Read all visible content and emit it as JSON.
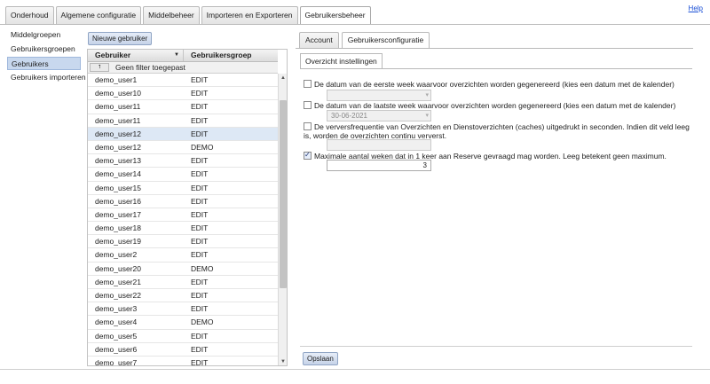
{
  "top_tabs": [
    {
      "label": "Onderhoud",
      "active": false
    },
    {
      "label": "Algemene configuratie",
      "active": false
    },
    {
      "label": "Middelbeheer",
      "active": false
    },
    {
      "label": "Importeren en Exporteren",
      "active": false
    },
    {
      "label": "Gebruikersbeheer",
      "active": true
    }
  ],
  "help_label": "Help",
  "left_nav": [
    {
      "label": "Middelgroepen",
      "active": false
    },
    {
      "label": "Gebruikersgroepen",
      "active": false
    },
    {
      "label": "Gebruikers",
      "active": true
    },
    {
      "label": "Gebruikers importeren",
      "active": false
    }
  ],
  "new_user_button": "Nieuwe gebruiker",
  "grid": {
    "col_user": "Gebruiker",
    "col_group": "Gebruikersgroep",
    "filter_button": "⭡",
    "filter_text": "Geen filter toegepast",
    "rows": [
      {
        "user": "demo_user1",
        "group": "EDIT"
      },
      {
        "user": "demo_user10",
        "group": "EDIT"
      },
      {
        "user": "demo_user11",
        "group": "EDIT"
      },
      {
        "user": "demo_user11",
        "group": "EDIT"
      },
      {
        "user": "demo_user12",
        "group": "EDIT",
        "selected": true
      },
      {
        "user": "demo_user12",
        "group": "DEMO"
      },
      {
        "user": "demo_user13",
        "group": "EDIT"
      },
      {
        "user": "demo_user14",
        "group": "EDIT"
      },
      {
        "user": "demo_user15",
        "group": "EDIT"
      },
      {
        "user": "demo_user16",
        "group": "EDIT"
      },
      {
        "user": "demo_user17",
        "group": "EDIT"
      },
      {
        "user": "demo_user18",
        "group": "EDIT"
      },
      {
        "user": "demo_user19",
        "group": "EDIT"
      },
      {
        "user": "demo_user2",
        "group": "EDIT"
      },
      {
        "user": "demo_user20",
        "group": "DEMO"
      },
      {
        "user": "demo_user21",
        "group": "EDIT"
      },
      {
        "user": "demo_user22",
        "group": "EDIT"
      },
      {
        "user": "demo_user3",
        "group": "EDIT"
      },
      {
        "user": "demo_user4",
        "group": "DEMO"
      },
      {
        "user": "demo_user5",
        "group": "EDIT"
      },
      {
        "user": "demo_user6",
        "group": "EDIT"
      },
      {
        "user": "demo_user7",
        "group": "EDIT"
      }
    ]
  },
  "right_tabs": [
    {
      "label": "Account",
      "active": false
    },
    {
      "label": "Gebruikersconfiguratie",
      "active": true
    }
  ],
  "sub_tab": "Overzicht instellingen",
  "settings": {
    "first_week": {
      "label": "De datum van de eerste week waarvoor overzichten worden gegenereerd (kies een datum met de kalender)",
      "checked": false,
      "value": ""
    },
    "last_week": {
      "label": "De datum van de laatste week waarvoor overzichten worden gegenereerd (kies een datum met de kalender)",
      "checked": false,
      "value": "30-06-2021"
    },
    "refresh": {
      "label": "De verversfrequentie van Overzichten en Dienstoverzichten (caches) uitgedrukt in seconden. Indien dit veld leeg is, worden de overzichten continu ververst.",
      "checked": false,
      "value": ""
    },
    "max_weeks": {
      "label": "Maximale aantal weken dat in 1 keer aan Reserve gevraagd mag worden. Leeg betekent geen maximum.",
      "checked": true,
      "value": "3"
    }
  },
  "save_button": "Opslaan",
  "colors": {
    "accent": "#c8d8ee",
    "selected_row": "#dde8f5",
    "link": "#1a4fd6"
  }
}
